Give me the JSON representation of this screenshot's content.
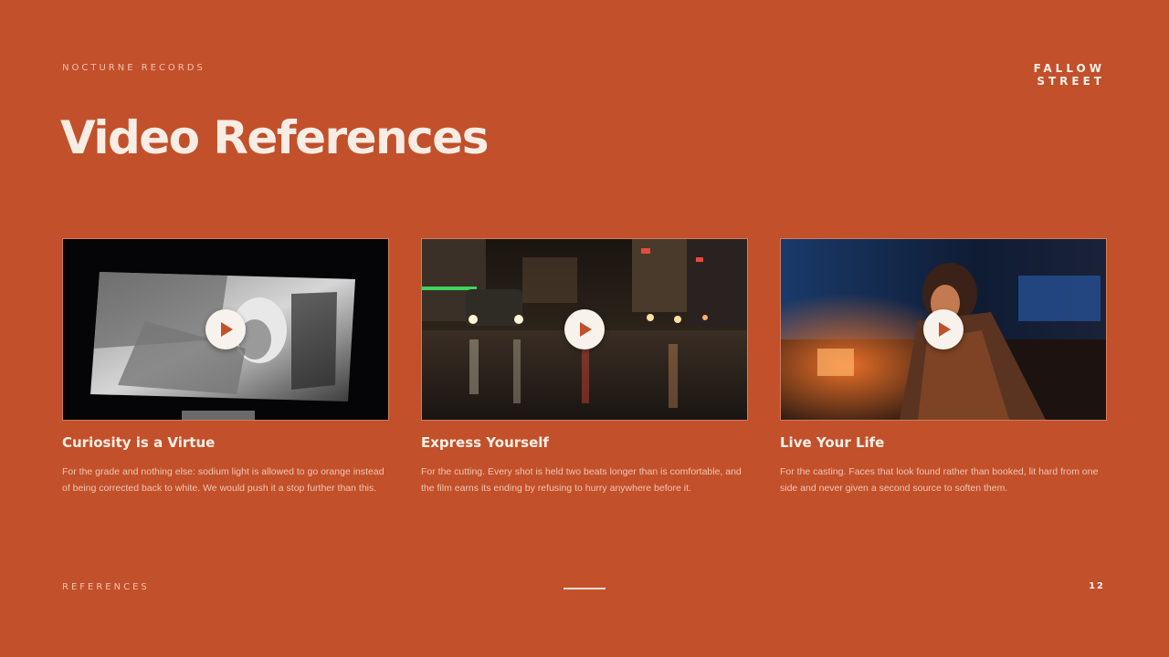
{
  "header": {
    "label": "NOCTURNE RECORDS",
    "logo_line1": "FALLOW",
    "logo_line2": "STREET"
  },
  "title": "Video References",
  "cards": [
    {
      "title": "Curiosity is a Virtue",
      "description": "For the grade and nothing else: sodium light is allowed to go orange instead of being corrected back to white. We would push it a stop further than this.",
      "icon": "play-icon"
    },
    {
      "title": "Express Yourself",
      "description": "For the cutting. Every shot is held two beats longer than is comfortable, and the film earns its ending by refusing to hurry anywhere before it.",
      "icon": "play-icon"
    },
    {
      "title": "Live Your Life",
      "description": "For the casting. Faces that look found rather than booked, lit hard from one side and never given a second source to soften them.",
      "icon": "play-icon"
    }
  ],
  "footer": {
    "section": "REFERENCES",
    "page_number": "12"
  },
  "colors": {
    "background": "#c2502b",
    "text_primary": "#f8ede4",
    "text_secondary": "#f0c6b1",
    "play_button": "#f8f2ec"
  }
}
